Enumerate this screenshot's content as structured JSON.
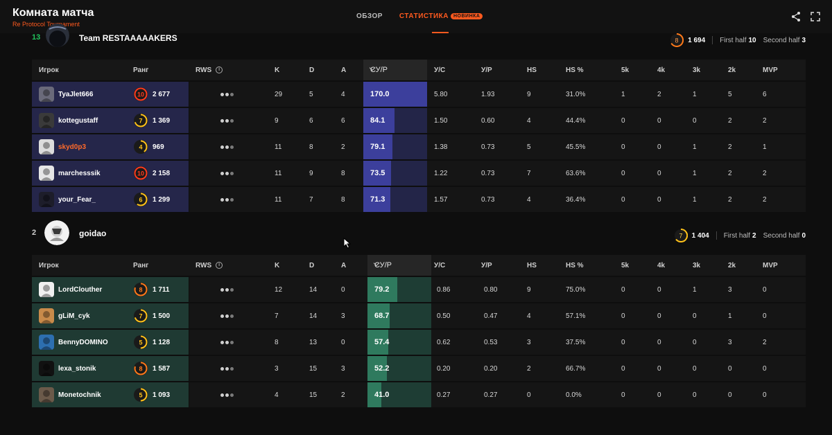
{
  "page": {
    "title": "Комната матча",
    "subtitle": "Re Protocol Tournament"
  },
  "nav": {
    "tabs": [
      {
        "label": "ОБЗОР"
      },
      {
        "label": "СТАТИСТИКА",
        "badge": "НОВИНКА"
      }
    ]
  },
  "icons": {
    "share": "share-icon",
    "expand": "expand-icon",
    "info": "info-icon",
    "chevron": "chevron-down-icon"
  },
  "colors": {
    "accent": "#ff5a1f",
    "team1_row": "#25264a",
    "team2_row": "#1f3a33",
    "team1_bar": "#3c3f9c",
    "team2_bar": "#2f7a5e",
    "win": "#22c55e"
  },
  "columns": {
    "player": "Игрок",
    "rank": "Ранг",
    "rws": "RWS",
    "k": "K",
    "d": "D",
    "a": "A",
    "kdr": "СУ/Р",
    "kr": "У/С",
    "dr": "У/Р",
    "hs": "HS",
    "hsp": "HS %",
    "k5": "5k",
    "k4": "4k",
    "k3": "3k",
    "k2": "2k",
    "mvp": "MVP"
  },
  "teams": [
    {
      "rank": "13",
      "name": "Team RESTAAAAAKERS",
      "avg_level": "8",
      "avg_elo": "1 694",
      "first_half_label": "First half",
      "first_half": "10",
      "second_half_label": "Second half",
      "second_half": "3",
      "players": [
        {
          "name": "TyaJlet666",
          "level": "10",
          "elo": "2 677",
          "k": "29",
          "d": "5",
          "a": "4",
          "kdr": "170.0",
          "kdr_fill": 1.0,
          "kr": "5.80",
          "dr": "1.93",
          "hs": "9",
          "hsp": "31.0%",
          "k5": "1",
          "k4": "2",
          "k3": "1",
          "k2": "5",
          "mvp": "6",
          "highlight": false
        },
        {
          "name": "kottegustaff",
          "level": "7",
          "elo": "1 369",
          "k": "9",
          "d": "6",
          "a": "6",
          "kdr": "84.1",
          "kdr_fill": 0.49,
          "kr": "1.50",
          "dr": "0.60",
          "hs": "4",
          "hsp": "44.4%",
          "k5": "0",
          "k4": "0",
          "k3": "0",
          "k2": "2",
          "mvp": "2",
          "highlight": false
        },
        {
          "name": "skyd0p3",
          "level": "4",
          "elo": "969",
          "k": "11",
          "d": "8",
          "a": "2",
          "kdr": "79.1",
          "kdr_fill": 0.46,
          "kr": "1.38",
          "dr": "0.73",
          "hs": "5",
          "hsp": "45.5%",
          "k5": "0",
          "k4": "0",
          "k3": "1",
          "k2": "2",
          "mvp": "1",
          "highlight": true
        },
        {
          "name": "marchesssik",
          "level": "10",
          "elo": "2 158",
          "k": "11",
          "d": "9",
          "a": "8",
          "kdr": "73.5",
          "kdr_fill": 0.43,
          "kr": "1.22",
          "dr": "0.73",
          "hs": "7",
          "hsp": "63.6%",
          "k5": "0",
          "k4": "0",
          "k3": "1",
          "k2": "2",
          "mvp": "2",
          "highlight": false
        },
        {
          "name": "your_Fear_",
          "level": "6",
          "elo": "1 299",
          "k": "11",
          "d": "7",
          "a": "8",
          "kdr": "71.3",
          "kdr_fill": 0.42,
          "kr": "1.57",
          "dr": "0.73",
          "hs": "4",
          "hsp": "36.4%",
          "k5": "0",
          "k4": "0",
          "k3": "1",
          "k2": "2",
          "mvp": "2",
          "highlight": false
        }
      ]
    },
    {
      "rank": "2",
      "name": "goidao",
      "avg_level": "7",
      "avg_elo": "1 404",
      "first_half_label": "First half",
      "first_half": "2",
      "second_half_label": "Second half",
      "second_half": "0",
      "players": [
        {
          "name": "LordClouther",
          "level": "8",
          "elo": "1 711",
          "k": "12",
          "d": "14",
          "a": "0",
          "kdr": "79.2",
          "kdr_fill": 0.47,
          "kr": "0.86",
          "dr": "0.80",
          "hs": "9",
          "hsp": "75.0%",
          "k5": "0",
          "k4": "0",
          "k3": "1",
          "k2": "3",
          "mvp": "0",
          "highlight": false
        },
        {
          "name": "gLiM_cyk",
          "level": "7",
          "elo": "1 500",
          "k": "7",
          "d": "14",
          "a": "3",
          "kdr": "68.7",
          "kdr_fill": 0.35,
          "kr": "0.50",
          "dr": "0.47",
          "hs": "4",
          "hsp": "57.1%",
          "k5": "0",
          "k4": "0",
          "k3": "0",
          "k2": "1",
          "mvp": "0",
          "highlight": false
        },
        {
          "name": "BennyDOMINO",
          "level": "5",
          "elo": "1 128",
          "k": "8",
          "d": "13",
          "a": "0",
          "kdr": "57.4",
          "kdr_fill": 0.33,
          "kr": "0.62",
          "dr": "0.53",
          "hs": "3",
          "hsp": "37.5%",
          "k5": "0",
          "k4": "0",
          "k3": "0",
          "k2": "3",
          "mvp": "2",
          "highlight": false
        },
        {
          "name": "lexa_stonik",
          "level": "8",
          "elo": "1 587",
          "k": "3",
          "d": "15",
          "a": "3",
          "kdr": "52.2",
          "kdr_fill": 0.3,
          "kr": "0.20",
          "dr": "0.20",
          "hs": "2",
          "hsp": "66.7%",
          "k5": "0",
          "k4": "0",
          "k3": "0",
          "k2": "0",
          "mvp": "0",
          "highlight": false
        },
        {
          "name": "Monetochnik",
          "level": "5",
          "elo": "1 093",
          "k": "4",
          "d": "15",
          "a": "2",
          "kdr": "41.0",
          "kdr_fill": 0.22,
          "kr": "0.27",
          "dr": "0.27",
          "hs": "0",
          "hsp": "0.0%",
          "k5": "0",
          "k4": "0",
          "k3": "0",
          "k2": "0",
          "mvp": "0",
          "highlight": false
        }
      ]
    }
  ]
}
